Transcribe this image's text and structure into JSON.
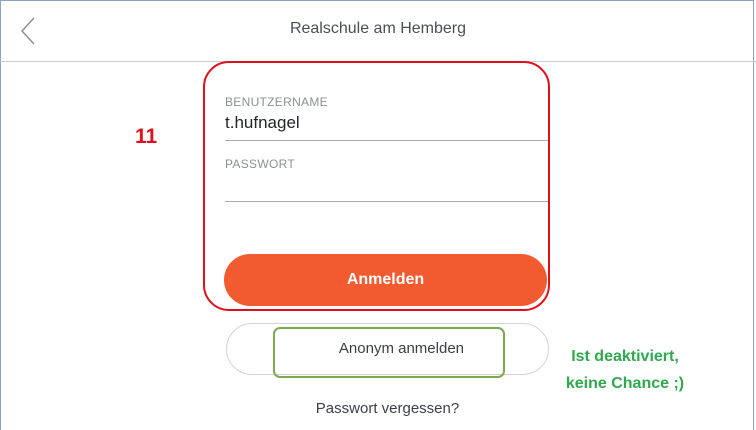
{
  "header": {
    "title": "Realschule am Hemberg",
    "back_icon": "chevron-left-icon"
  },
  "login_form": {
    "username": {
      "label": "BENUTZERNAME",
      "value": "t.hufnagel"
    },
    "password": {
      "label": "PASSWORT",
      "value": ""
    },
    "login_button_label": "Anmelden"
  },
  "anonymous_button_label": "Anonym anmelden",
  "forgot_password_label": "Passwort vergessen?",
  "annotations": {
    "step_number": "11",
    "note_line1": "Ist deaktiviert,",
    "note_line2": "keine Chance ;)"
  },
  "colors": {
    "primary_button": "#f25a2f",
    "annotation_red": "#e0101a",
    "annotation_green": "#2fa84f",
    "annotation_green_box": "#7aab4e"
  }
}
